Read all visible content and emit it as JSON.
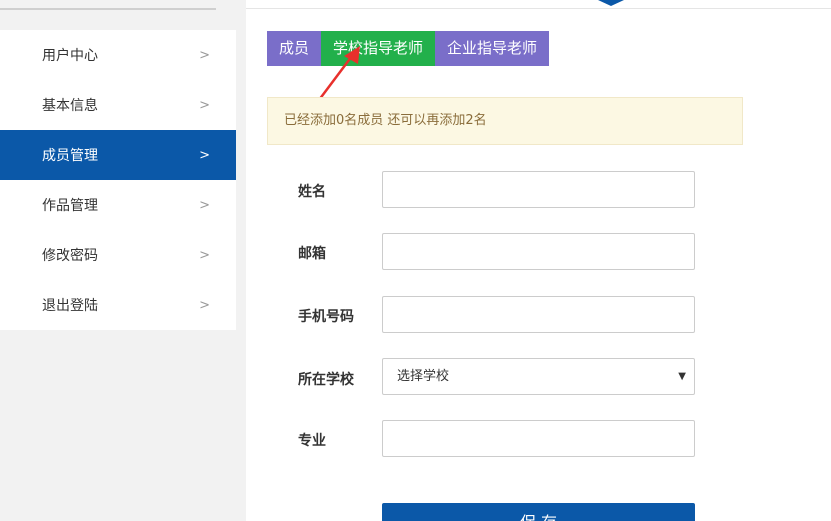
{
  "sidebar": {
    "items": [
      {
        "label": "用户中心"
      },
      {
        "label": "基本信息"
      },
      {
        "label": "成员管理"
      },
      {
        "label": "作品管理"
      },
      {
        "label": "修改密码"
      },
      {
        "label": "退出登陆"
      }
    ],
    "active_index": 2,
    "chevron": ">"
  },
  "tabs": {
    "members": "成员",
    "school_teacher": "学校指导老师",
    "company_teacher": "企业指导老师",
    "active": "school_teacher"
  },
  "notice": {
    "text": "已经添加0名成员 还可以再添加2名"
  },
  "form": {
    "name_label": "姓名",
    "email_label": "邮箱",
    "phone_label": "手机号码",
    "school_label": "所在学校",
    "school_selected": "选择学校",
    "major_label": "专业",
    "save_label": "保 存"
  },
  "colors": {
    "primary": "#0b58a8",
    "tab_purple": "#7a6ec9",
    "tab_green": "#22b04b",
    "annotation_red": "#e8302c",
    "notice_bg": "#fcf8e3"
  }
}
